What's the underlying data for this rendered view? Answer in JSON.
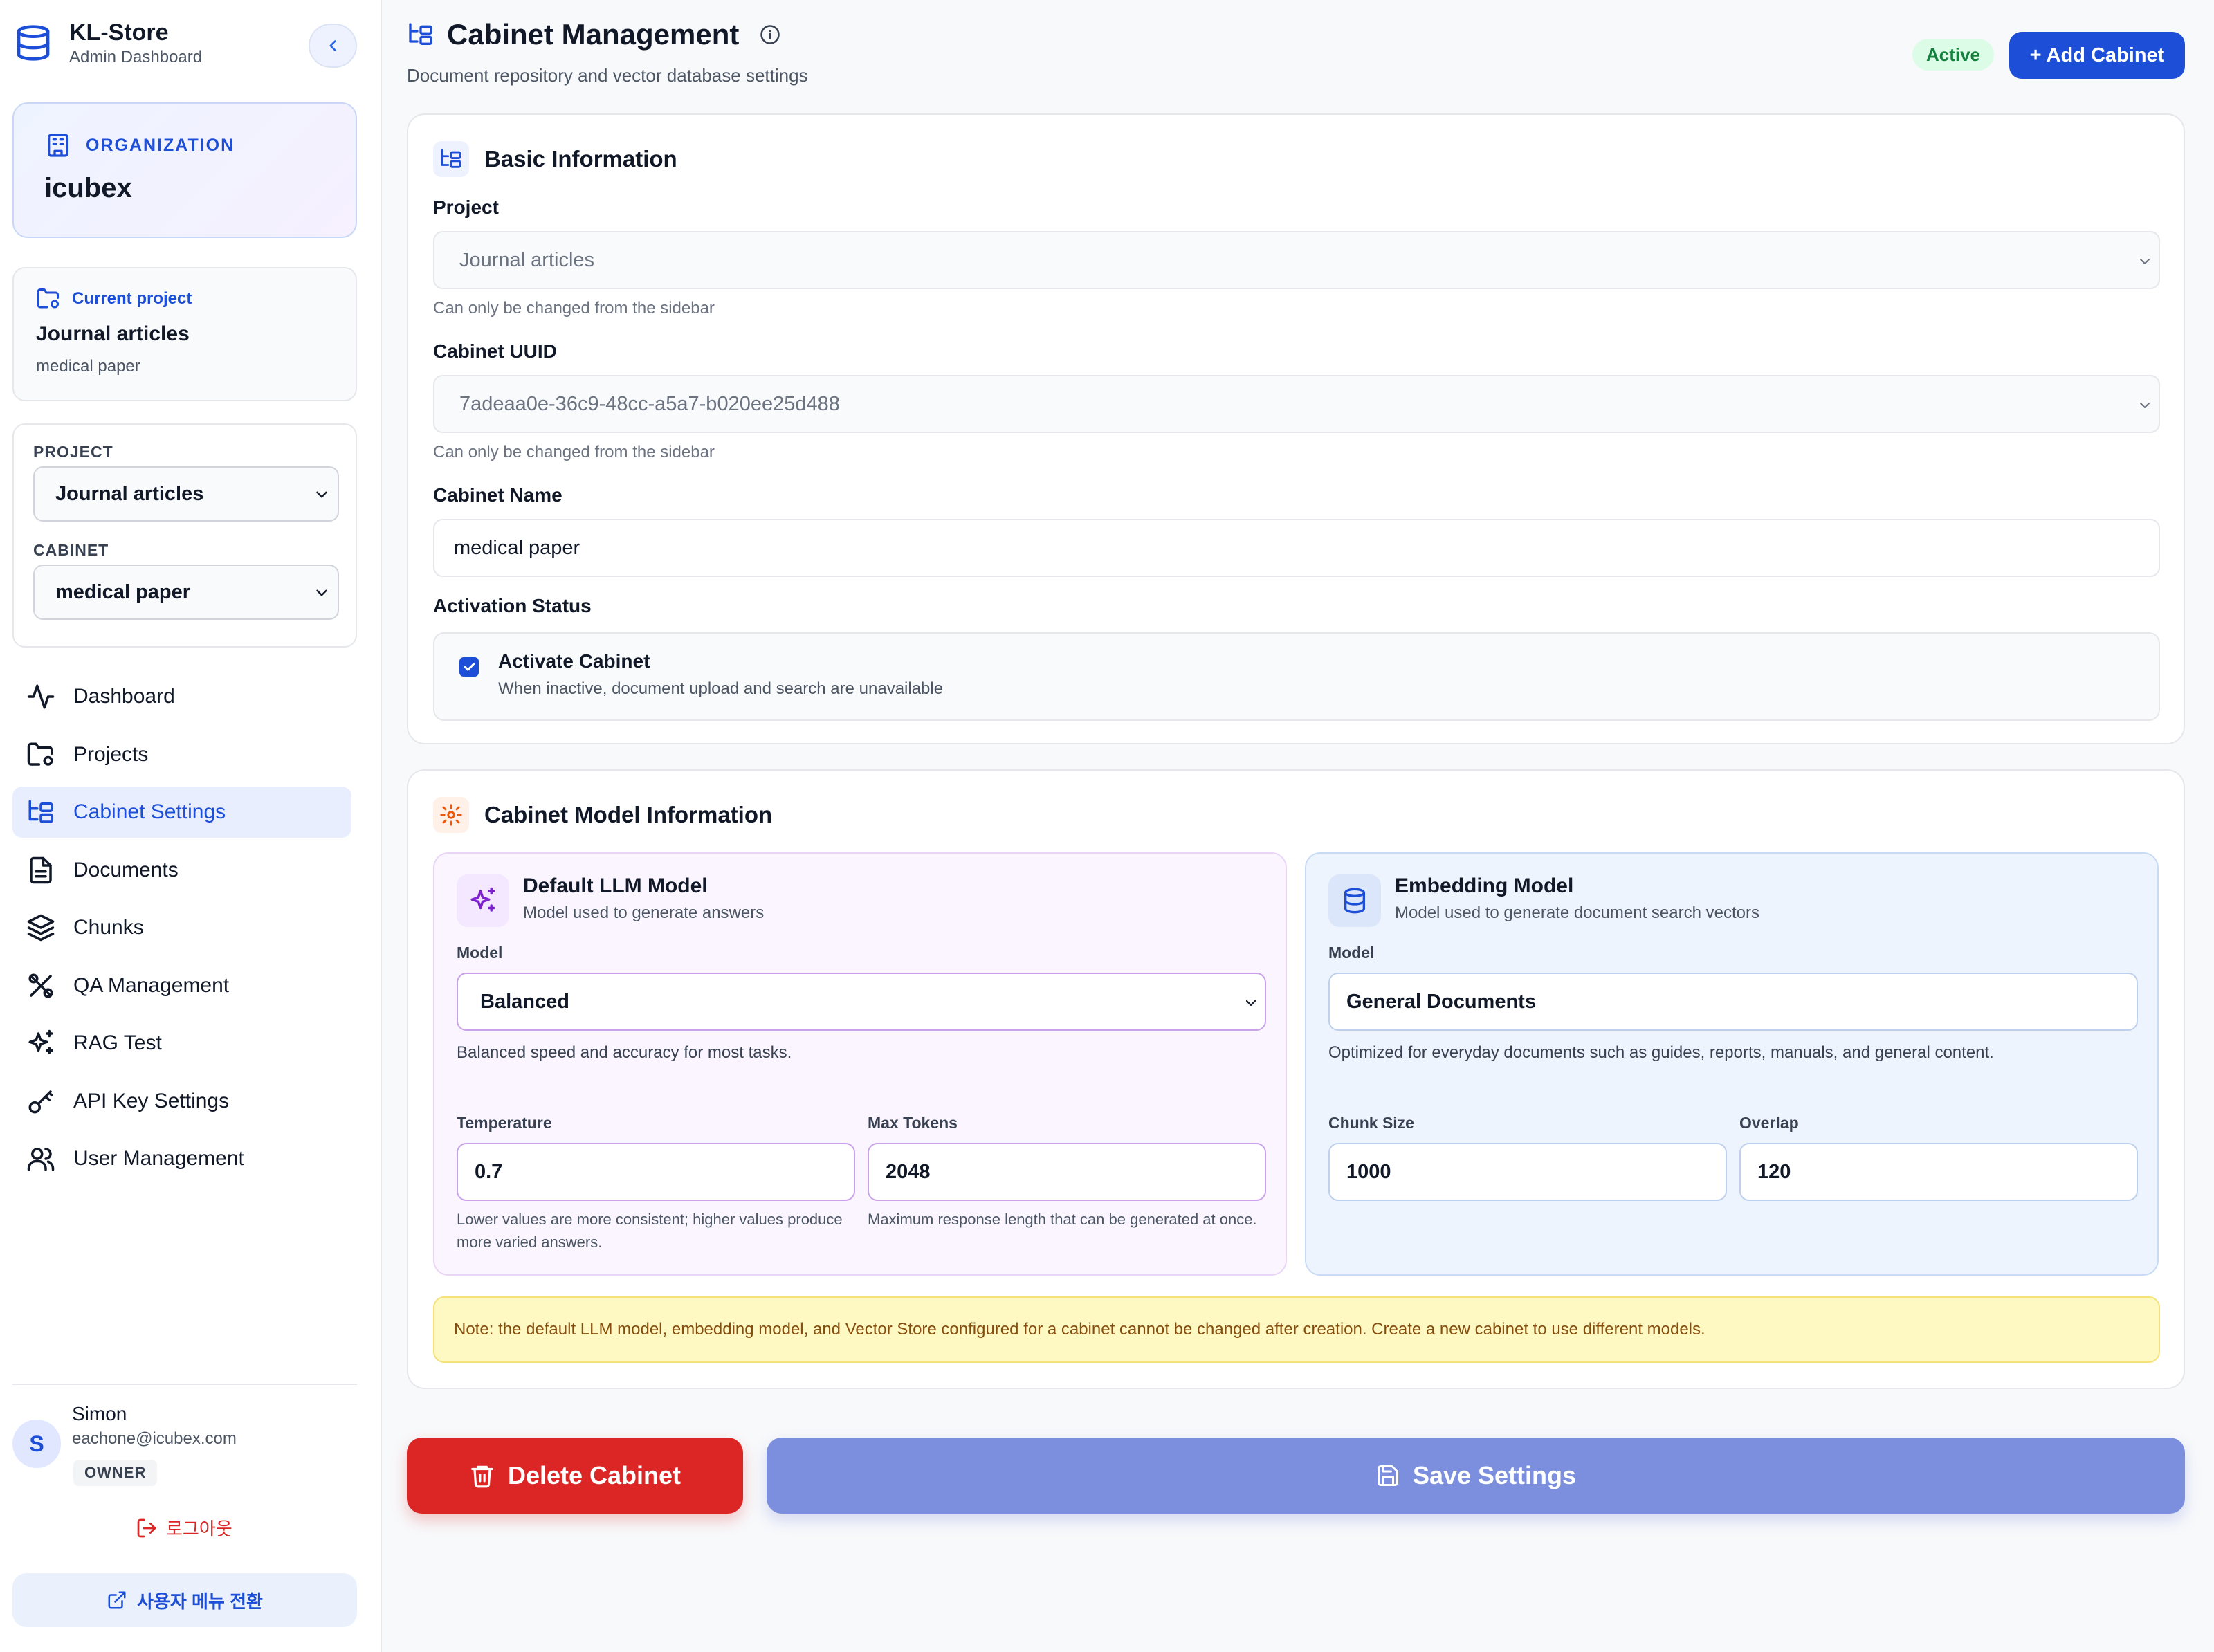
{
  "brand": {
    "title": "KL-Store",
    "subtitle": "Admin Dashboard"
  },
  "organization": {
    "label": "ORGANIZATION",
    "name": "icubex"
  },
  "current_project": {
    "label": "Current project",
    "name": "Journal articles",
    "cabinet": "medical paper"
  },
  "selectors": {
    "project_label": "PROJECT",
    "project_value": "Journal articles",
    "cabinet_label": "CABINET",
    "cabinet_value": "medical paper"
  },
  "nav": [
    {
      "label": "Dashboard",
      "icon": "activity-icon",
      "active": false
    },
    {
      "label": "Projects",
      "icon": "folder-settings-icon",
      "active": false
    },
    {
      "label": "Cabinet Settings",
      "icon": "folder-tree-icon",
      "active": true
    },
    {
      "label": "Documents",
      "icon": "document-icon",
      "active": false
    },
    {
      "label": "Chunks",
      "icon": "layers-icon",
      "active": false
    },
    {
      "label": "QA Management",
      "icon": "tools-icon",
      "active": false
    },
    {
      "label": "RAG Test",
      "icon": "sparkles-icon",
      "active": false
    },
    {
      "label": "API Key Settings",
      "icon": "key-icon",
      "active": false
    },
    {
      "label": "User Management",
      "icon": "users-icon",
      "active": false
    }
  ],
  "user": {
    "initial": "S",
    "name": "Simon",
    "email": "eachone@icubex.com",
    "role": "OWNER"
  },
  "logout_label": "로그아웃",
  "switch_label": "사용자 메뉴 전환",
  "header": {
    "title": "Cabinet Management",
    "subtitle": "Document repository and vector database settings",
    "status": "Active",
    "add_button": "+ Add Cabinet"
  },
  "basic": {
    "title": "Basic Information",
    "project_label": "Project",
    "project_value": "Journal articles",
    "project_hint": "Can only be changed from the sidebar",
    "uuid_label": "Cabinet UUID",
    "uuid_value": "7adeaa0e-36c9-48cc-a5a7-b020ee25d488",
    "uuid_hint": "Can only be changed from the sidebar",
    "name_label": "Cabinet Name",
    "name_value": "medical paper",
    "status_label": "Activation Status",
    "activate_title": "Activate Cabinet",
    "activate_desc": "When inactive, document upload and search are unavailable",
    "activate_checked": true
  },
  "model": {
    "title": "Cabinet Model Information",
    "llm": {
      "title": "Default LLM Model",
      "desc": "Model used to generate answers",
      "model_label": "Model",
      "model_value": "Balanced",
      "model_desc": "Balanced speed and accuracy for most tasks.",
      "temp_label": "Temperature",
      "temp_value": "0.7",
      "temp_hint": "Lower values are more consistent; higher values produce more varied answers.",
      "tokens_label": "Max Tokens",
      "tokens_value": "2048",
      "tokens_hint": "Maximum response length that can be generated at once."
    },
    "embedding": {
      "title": "Embedding Model",
      "desc": "Model used to generate document search vectors",
      "model_label": "Model",
      "model_value": "General Documents",
      "model_desc": "Optimized for everyday documents such as guides, reports, manuals, and general content.",
      "chunk_label": "Chunk Size",
      "chunk_value": "1000",
      "overlap_label": "Overlap",
      "overlap_value": "120"
    },
    "note": "Note: the default LLM model, embedding model, and Vector Store configured for a cabinet cannot be changed after creation. Create a new cabinet to use different models."
  },
  "actions": {
    "delete": "Delete Cabinet",
    "save": "Save Settings"
  },
  "colors": {
    "accent": "#1d4ed8",
    "danger": "#dc2626",
    "save": "#7b8fde",
    "success": "#15803d"
  }
}
